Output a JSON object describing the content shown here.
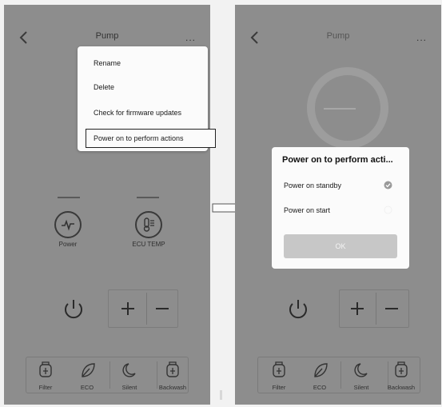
{
  "left": {
    "title": "Pump",
    "more": "...",
    "menu": {
      "items": [
        "Rename",
        "Delete",
        "Check for firmware updates",
        "Power on to perform actions"
      ]
    },
    "status": {
      "power_label": "Power",
      "ecu_label": "ECU TEMP"
    },
    "bottom": [
      "Filter",
      "ECO",
      "Silent",
      "Backwash"
    ]
  },
  "right": {
    "title": "Pump",
    "more": "...",
    "dialog": {
      "title": "Power on to perform acti...",
      "options": [
        "Power on standby",
        "Power on start"
      ],
      "selected": "Power on standby",
      "ok": "OK"
    },
    "bottom": [
      "Filter",
      "ECO",
      "Silent",
      "Backwash"
    ]
  },
  "icons": {
    "back": "chevron-left-icon",
    "power_status": "pulse-icon",
    "ecu": "thermometer-icon",
    "power": "power-icon",
    "filter": "filter-icon",
    "eco": "leaf-icon",
    "silent": "moon-icon",
    "backwash": "backwash-icon"
  },
  "colors": {
    "screen_bg": "#8d8d8d",
    "dialog_bg": "#fbfbfb",
    "ok_bg": "#c7c7c7"
  }
}
